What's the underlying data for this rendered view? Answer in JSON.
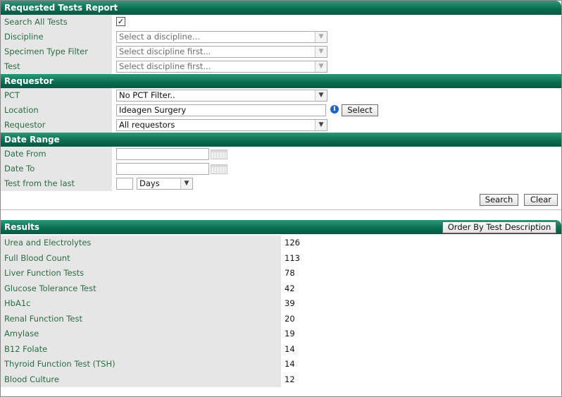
{
  "report": {
    "title": "Requested Tests Report",
    "search_all_label": "Search All Tests",
    "search_all_checked": true,
    "discipline_label": "Discipline",
    "discipline_value": "Select a discipline...",
    "specimen_label": "Specimen Type Filter",
    "specimen_value": "Select discipline first...",
    "test_label": "Test",
    "test_value": "Select discipline first..."
  },
  "requestor": {
    "title": "Requestor",
    "pct_label": "PCT",
    "pct_value": "No PCT Filter..",
    "location_label": "Location",
    "location_value": "Ideagen Surgery",
    "select_button": "Select",
    "requestor_label": "Requestor",
    "requestor_value": "All requestors"
  },
  "date_range": {
    "title": "Date Range",
    "date_from_label": "Date From",
    "date_from_value": "",
    "date_to_label": "Date To",
    "date_to_value": "",
    "test_from_last_label": "Test from the last",
    "test_from_last_value": "",
    "period_unit": "Days",
    "search_button": "Search",
    "clear_button": "Clear"
  },
  "results": {
    "title": "Results",
    "order_button": "Order By Test Description",
    "rows": [
      {
        "name": "Urea and Electrolytes",
        "count": "126"
      },
      {
        "name": "Full Blood Count",
        "count": "113"
      },
      {
        "name": "Liver Function Tests",
        "count": "78"
      },
      {
        "name": "Glucose Tolerance Test",
        "count": "42"
      },
      {
        "name": "HbA1c",
        "count": "39"
      },
      {
        "name": "Renal Function Test",
        "count": "20"
      },
      {
        "name": "Amylase",
        "count": "19"
      },
      {
        "name": "B12 Folate",
        "count": "14"
      },
      {
        "name": "Thyroid Function Test (TSH)",
        "count": "14"
      },
      {
        "name": "Blood Culture",
        "count": "12"
      }
    ]
  },
  "icons": {
    "dropdown": "chevron-down-icon",
    "checkmark": "checkmark-icon",
    "info": "info-icon",
    "calendar": "calendar-icon"
  },
  "colors": {
    "header": "#0b6e50",
    "label_text": "#2b6d44",
    "label_bg": "#e6e6e6"
  }
}
